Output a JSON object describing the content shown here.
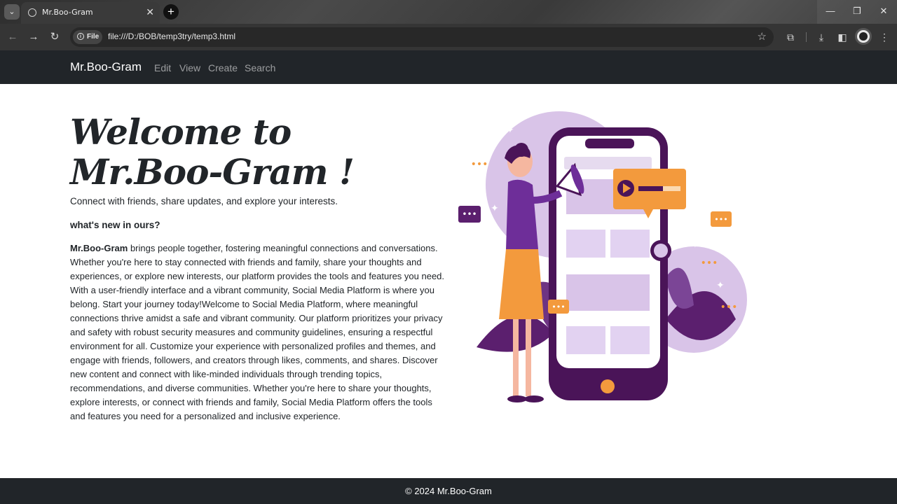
{
  "browser": {
    "tab_title": "Mr.Boo-Gram",
    "url_chip": "File",
    "url": "file:///D:/BOB/temp3try/temp3.html"
  },
  "navbar": {
    "brand": "Mr.Boo-Gram",
    "links": [
      "Edit",
      "View",
      "Create",
      "Search"
    ]
  },
  "hero": {
    "title_line1": "Welcome to",
    "title_line2": "Mr.Boo-Gram !",
    "lead": "Connect with friends, share updates, and explore your interests.",
    "subheading": "what's new in ours?",
    "body_bold": "Mr.Boo-Gram",
    "body_rest": " brings people together, fostering meaningful connections and conversations. Whether you're here to stay connected with friends and family, share your thoughts and experiences, or explore new interests, our platform provides the tools and features you need. With a user-friendly interface and a vibrant community, Social Media Platform is where you belong. Start your journey today!Welcome to Social Media Platform, where meaningful connections thrive amidst a safe and vibrant community. Our platform prioritizes your privacy and safety with robust security measures and community guidelines, ensuring a respectful environment for all. Customize your experience with personalized profiles and themes, and engage with friends, followers, and creators through likes, comments, and shares. Discover new content and connect with like-minded individuals through trending topics, recommendations, and diverse communities. Whether you're here to share your thoughts, explore interests, or connect with friends and family, Social Media Platform offers the tools and features you need for a personalized and inclusive experience."
  },
  "footer": {
    "text": "© 2024 Mr.Boo-Gram"
  },
  "colors": {
    "navbar_bg": "#212529",
    "accent_purple": "#5b1f6e",
    "accent_orange": "#f39a3d",
    "lavender": "#d9c4e8"
  }
}
